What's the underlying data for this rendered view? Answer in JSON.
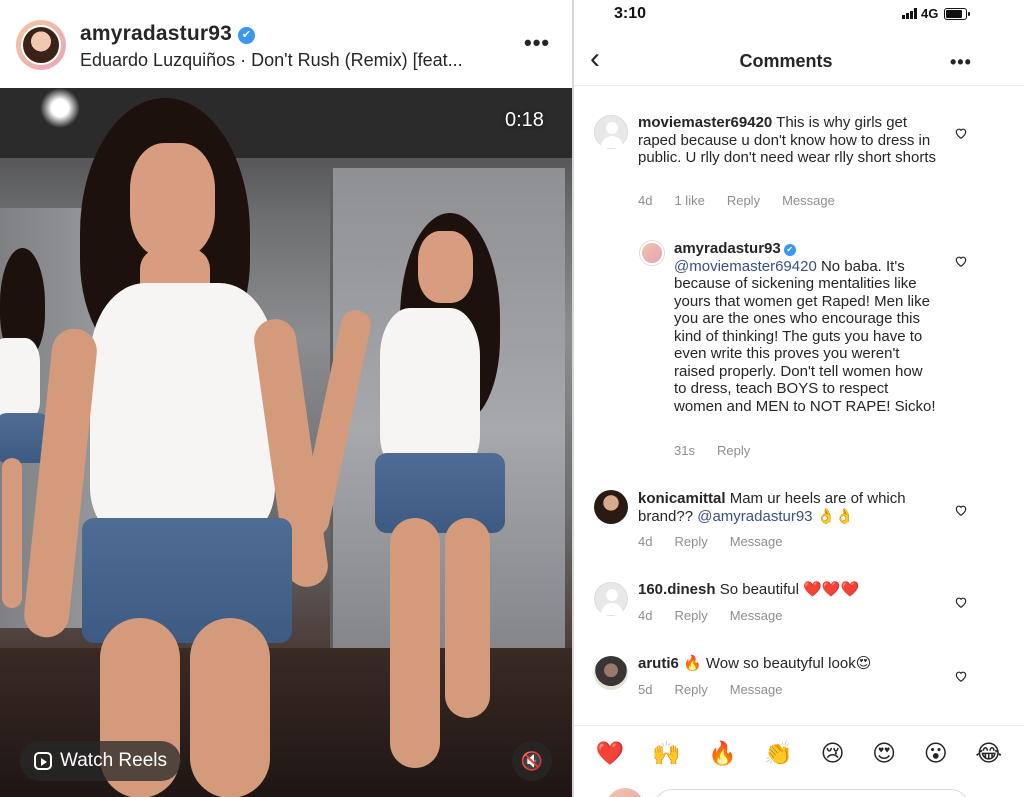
{
  "post": {
    "username": "amyradastur93",
    "verified_mark": "✔",
    "song": "Eduardo Luzquiños · Don't Rush (Remix) [feat...",
    "more": "•••",
    "video_timer": "0:18",
    "watch_reels_label": "Watch Reels",
    "mute_icon": "🔇"
  },
  "status_bar": {
    "time": "3:10",
    "network": "4G"
  },
  "comments_screen": {
    "back_glyph": "‹",
    "title": "Comments",
    "more": "•••",
    "comments": [
      {
        "user": "moviemaster69420",
        "text": "This is why girls get raped because u don't know how to dress in public. U rlly don't need wear rlly short shorts",
        "age": "4d",
        "likes": "1 like",
        "reply": "Reply",
        "message": "Message",
        "avatar": "default"
      },
      {
        "user": "amyradastur93",
        "mention": "@moviemaster69420",
        "text": "No baba. It's because of sickening mentalities like yours that women get Raped! Men like you are the ones who encourage this kind of thinking! The guts you have to even write this proves you weren't raised properly. Don't tell women how to dress, teach BOYS to respect women and MEN to NOT RAPE! Sicko!",
        "age": "31s",
        "reply": "Reply",
        "avatar": "reply-photo"
      },
      {
        "user": "konicamittal",
        "text": "Mam ur heels are of which brand??",
        "mention": "@amyradastur93",
        "emoji": "👌👌",
        "age": "4d",
        "reply": "Reply",
        "message": "Message",
        "avatar": "photo"
      },
      {
        "user": "160.dinesh",
        "text": "So beautiful",
        "emoji": "❤️❤️❤️",
        "age": "4d",
        "reply": "Reply",
        "message": "Message",
        "avatar": "default"
      },
      {
        "user": "aruti6",
        "prefix_emoji": "🔥",
        "text": "Wow so beautyful look",
        "emoji": "😍",
        "age": "5d",
        "reply": "Reply",
        "message": "Message",
        "avatar": "photo"
      }
    ],
    "emoji_bar": [
      "❤️",
      "🙌",
      "🔥",
      "👏",
      "😢",
      "😍",
      "😮",
      "😂"
    ]
  },
  "colors": {
    "verified": "#3897f0",
    "mention": "#385185",
    "meta": "#8e8e8e",
    "text": "#262626"
  }
}
